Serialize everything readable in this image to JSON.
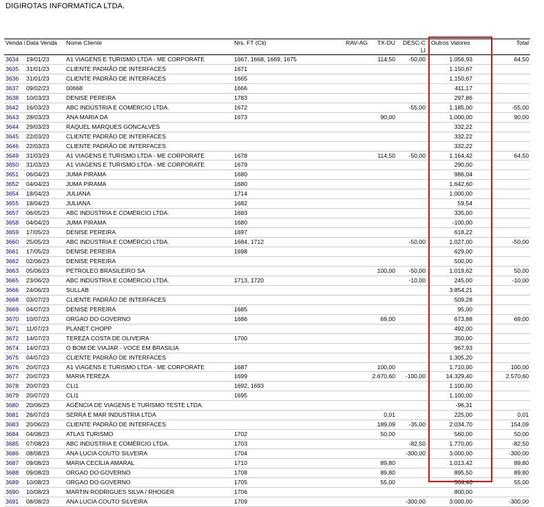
{
  "company": "DIGIROTAS INFORMATICA LTDA.",
  "headers": {
    "venda": "Venda Nº",
    "data": "Data Venda",
    "cliente": "Nome Cliente",
    "nrs": "Nrs. FT (Cli)",
    "rav": "RAV-AG",
    "tx": "TX-DU",
    "desc": "DESC-C LI",
    "outros": "Outros Valores",
    "total": "Total"
  },
  "highlight_color": "#e01010",
  "rows": [
    {
      "venda": "3634",
      "data": "19/01/23",
      "cliente": "A1 VIAGENS E TURISMO LTDA - ME CORPORATE",
      "nrs": "1667, 1668, 1669, 1675",
      "rav": "",
      "tx": "114,50",
      "desc": "-50,00",
      "outros": "1.056,93",
      "total": "64,50"
    },
    {
      "venda": "3635",
      "data": "31/01/23",
      "cliente": "CLIENTE PADRÃO DE INTERFACES",
      "nrs": "1671",
      "rav": "",
      "tx": "",
      "desc": "",
      "outros": "1.150,67",
      "total": ""
    },
    {
      "venda": "3636",
      "data": "31/01/23",
      "cliente": "CLIENTE PADRÃO DE INTERFACES",
      "nrs": "1665",
      "rav": "",
      "tx": "",
      "desc": "",
      "outros": "1.150,67",
      "total": ""
    },
    {
      "venda": "3637",
      "data": "09/02/23",
      "cliente": "00668",
      "nrs": "1666",
      "rav": "",
      "tx": "",
      "desc": "",
      "outros": "411,17",
      "total": ""
    },
    {
      "venda": "3638",
      "data": "10/03/23",
      "cliente": "DENISE PEREIRA",
      "nrs": "1783",
      "rav": "",
      "tx": "",
      "desc": "",
      "outros": "297,86",
      "total": ""
    },
    {
      "venda": "3642",
      "data": "16/03/23",
      "cliente": "ABC INDÚSTRIA E COMÉRCIO LTDA.",
      "nrs": "1672",
      "rav": "",
      "tx": "",
      "desc": "-55,00",
      "outros": "1.185,00",
      "total": "-55,00"
    },
    {
      "venda": "3643",
      "data": "28/03/23",
      "cliente": "ANA MARIA DA",
      "nrs": "1673",
      "rav": "",
      "tx": "90,00",
      "desc": "",
      "outros": "1.000,00",
      "total": "90,00"
    },
    {
      "venda": "3644",
      "data": "29/03/23",
      "cliente": "RAQUEL MARQUES GONCALVES",
      "nrs": "",
      "rav": "",
      "tx": "",
      "desc": "",
      "outros": "332,22",
      "total": ""
    },
    {
      "venda": "3645",
      "data": "22/03/23",
      "cliente": "CLIENTE PADRÃO DE INTERFACES",
      "nrs": "",
      "rav": "",
      "tx": "",
      "desc": "",
      "outros": "332,22",
      "total": ""
    },
    {
      "venda": "3646",
      "data": "22/03/23",
      "cliente": "CLIENTE PADRÃO DE INTERFACES",
      "nrs": "",
      "rav": "",
      "tx": "",
      "desc": "",
      "outros": "332,22",
      "total": ""
    },
    {
      "venda": "3649",
      "data": "31/03/23",
      "cliente": "A1 VIAGENS E TURISMO LTDA - ME CORPORATE",
      "nrs": "1678",
      "rav": "",
      "tx": "114,50",
      "desc": "-50,00",
      "outros": "1.164,42",
      "total": "64,50"
    },
    {
      "venda": "3650",
      "data": "31/03/23",
      "cliente": "A1 VIAGENS E TURISMO LTDA - ME CORPORATE",
      "nrs": "1679",
      "rav": "",
      "tx": "",
      "desc": "",
      "outros": "290,00",
      "total": ""
    },
    {
      "venda": "3651",
      "data": "06/04/23",
      "cliente": "JUMA PIRAMA",
      "nrs": "1680",
      "rav": "",
      "tx": "",
      "desc": "",
      "outros": "986,04",
      "total": ""
    },
    {
      "venda": "3652",
      "data": "04/04/23",
      "cliente": "JUMA PIRAMA",
      "nrs": "1680",
      "rav": "",
      "tx": "",
      "desc": "",
      "outros": "1.642,60",
      "total": ""
    },
    {
      "venda": "3654",
      "data": "18/04/23",
      "cliente": "JULIANA",
      "nrs": "1714",
      "rav": "",
      "tx": "",
      "desc": "",
      "outros": "1.000,00",
      "total": ""
    },
    {
      "venda": "3655",
      "data": "18/04/23",
      "cliente": "JULIANA",
      "nrs": "1682",
      "rav": "",
      "tx": "",
      "desc": "",
      "outros": "59,54",
      "total": ""
    },
    {
      "venda": "3657",
      "data": "06/05/23",
      "cliente": "ABC INDÚSTRIA E COMÉRCIO LTDA.",
      "nrs": "1683",
      "rav": "",
      "tx": "",
      "desc": "",
      "outros": "335,00",
      "total": ""
    },
    {
      "venda": "3658",
      "data": "04/04/23",
      "cliente": "JUMA PIRAMA",
      "nrs": "1680",
      "rav": "",
      "tx": "",
      "desc": "",
      "outros": "-100,00",
      "total": ""
    },
    {
      "venda": "3659",
      "data": "17/05/23",
      "cliente": "DENISE PEREIRA",
      "nrs": "1697",
      "rav": "",
      "tx": "",
      "desc": "",
      "outros": "618,22",
      "total": ""
    },
    {
      "venda": "3660",
      "data": "25/05/23",
      "cliente": "ABC INDÚSTRIA E COMÉRCIO LTDA.",
      "nrs": "1684, 1712",
      "rav": "",
      "tx": "",
      "desc": "-50,00",
      "outros": "1.027,00",
      "total": "-50,00"
    },
    {
      "venda": "3661",
      "data": "17/05/23",
      "cliente": "DENISE PEREIRA",
      "nrs": "1698",
      "rav": "",
      "tx": "",
      "desc": "",
      "outros": "629,00",
      "total": ""
    },
    {
      "venda": "3662",
      "data": "02/06/23",
      "cliente": "DENISE PEREIRA",
      "nrs": "",
      "rav": "",
      "tx": "",
      "desc": "",
      "outros": "500,00",
      "total": ""
    },
    {
      "venda": "3663",
      "data": "05/06/23",
      "cliente": "PETROLEO BRASILEIRO SA",
      "nrs": "",
      "rav": "",
      "tx": "100,00",
      "desc": "-50,00",
      "outros": "1.019,62",
      "total": "50,00"
    },
    {
      "venda": "3665",
      "data": "23/06/23",
      "cliente": "ABC INDÚSTRIA E COMÉRCIO LTDA.",
      "nrs": "1713, 1720",
      "rav": "",
      "tx": "",
      "desc": "-10,00",
      "outros": "245,00",
      "total": "-10,00"
    },
    {
      "venda": "3666",
      "data": "24/06/23",
      "cliente": "SULLAB",
      "nrs": "",
      "rav": "",
      "tx": "",
      "desc": "",
      "outros": "3.854,21",
      "total": ""
    },
    {
      "venda": "3668",
      "data": "03/07/23",
      "cliente": "CLIENTE PADRÃO DE INTERFACES",
      "nrs": "",
      "rav": "",
      "tx": "",
      "desc": "",
      "outros": "509,28",
      "total": ""
    },
    {
      "venda": "3669",
      "data": "04/07/23",
      "cliente": "DENISE PEREIRA",
      "nrs": "1685",
      "rav": "",
      "tx": "",
      "desc": "",
      "outros": "95,00",
      "total": ""
    },
    {
      "venda": "3670",
      "data": "10/07/23",
      "cliente": "ORGAO DO GOVERNO",
      "nrs": "1686",
      "rav": "",
      "tx": "69,00",
      "desc": "",
      "outros": "673,88",
      "total": "69,00"
    },
    {
      "venda": "3671",
      "data": "11/07/23",
      "cliente": "PLANET CHOPP",
      "nrs": "",
      "rav": "",
      "tx": "",
      "desc": "",
      "outros": "492,00",
      "total": ""
    },
    {
      "venda": "3672",
      "data": "14/07/23",
      "cliente": "TEREZA COSTA DE OLIVEIRA",
      "nrs": "1700",
      "rav": "",
      "tx": "",
      "desc": "",
      "outros": "350,00",
      "total": ""
    },
    {
      "venda": "3674",
      "data": "14/07/23",
      "cliente": "O BOM DE VIAJAR - VOCE EM BRASILIA",
      "nrs": "",
      "rav": "",
      "tx": "",
      "desc": "",
      "outros": "967,93",
      "total": ""
    },
    {
      "venda": "3675",
      "data": "04/07/23",
      "cliente": "CLIENTE PADRÃO DE INTERFACES",
      "nrs": "",
      "rav": "",
      "tx": "",
      "desc": "",
      "outros": "1.305,20",
      "total": ""
    },
    {
      "venda": "3676",
      "data": "20/07/23",
      "cliente": "A1 VIAGENS E TURISMO LTDA - ME CORPORATE",
      "nrs": "1687",
      "rav": "",
      "tx": "100,00",
      "desc": "",
      "outros": "1.710,00",
      "total": "100,00"
    },
    {
      "venda": "3677",
      "data": "20/07/23",
      "cliente": "MARIA TEREZA",
      "nrs": "1699",
      "rav": "",
      "tx": "2.670,60",
      "desc": "-100,00",
      "outros": "14.329,40",
      "total": "2.570,60"
    },
    {
      "venda": "3678",
      "data": "20/07/23",
      "cliente": "CLI1",
      "nrs": "1692, 1693",
      "rav": "",
      "tx": "",
      "desc": "",
      "outros": "1.100,00",
      "total": ""
    },
    {
      "venda": "3679",
      "data": "20/07/23",
      "cliente": "CLI1",
      "nrs": "1695",
      "rav": "",
      "tx": "",
      "desc": "",
      "outros": "1.100,00",
      "total": ""
    },
    {
      "venda": "3680",
      "data": "20/06/23",
      "cliente": "AGÊNCIA DE VIAGENS E TURISMO TESTE LTDA.",
      "nrs": "",
      "rav": "",
      "tx": "",
      "desc": "",
      "outros": "-96,31",
      "total": ""
    },
    {
      "venda": "3681",
      "data": "26/07/23",
      "cliente": "SERRA E MAR INDUSTRIA LTDA",
      "nrs": "",
      "rav": "",
      "tx": "0,01",
      "desc": "",
      "outros": "225,00",
      "total": "0,01"
    },
    {
      "venda": "3683",
      "data": "20/06/23",
      "cliente": "CLIENTE PADRÃO DE INTERFACES",
      "nrs": "",
      "rav": "",
      "tx": "189,09",
      "desc": "-35,00",
      "outros": "2.034,70",
      "total": "154,09"
    },
    {
      "venda": "3684",
      "data": "04/08/23",
      "cliente": "ATLAS TURISMO",
      "nrs": "1702",
      "rav": "",
      "tx": "50,00",
      "desc": "",
      "outros": "560,00",
      "total": "50,00"
    },
    {
      "venda": "3685",
      "data": "07/08/23",
      "cliente": "ABC INDÚSTRIA E COMÉRCIO LTDA.",
      "nrs": "1703",
      "rav": "",
      "tx": "",
      "desc": "-82,50",
      "outros": "1.770,00",
      "total": "-82,50"
    },
    {
      "venda": "3686",
      "data": "08/08/23",
      "cliente": "ANA LUCIA COUTO SILVEIRA",
      "nrs": "1704",
      "rav": "",
      "tx": "",
      "desc": "-300,00",
      "outros": "3.000,00",
      "total": "-300,00"
    },
    {
      "venda": "3687",
      "data": "09/08/23",
      "cliente": "MARIA CECÍLIA AMARAL",
      "nrs": "1710",
      "rav": "",
      "tx": "89,80",
      "desc": "",
      "outros": "1.013,42",
      "total": "89,80"
    },
    {
      "venda": "3688",
      "data": "09/08/23",
      "cliente": "ORGAO DO GOVERNO",
      "nrs": "1708",
      "rav": "",
      "tx": "89,80",
      "desc": "",
      "outros": "895,50",
      "total": "89,80"
    },
    {
      "venda": "3689",
      "data": "10/08/23",
      "cliente": "ORGAO DO GOVERNO",
      "nrs": "1705",
      "rav": "",
      "tx": "55,00",
      "desc": "",
      "outros": "564,46",
      "total": "55,00"
    },
    {
      "venda": "3690",
      "data": "10/08/23",
      "cliente": "MARTIN RODRIGUES SILVA / RHOGER",
      "nrs": "1706",
      "rav": "",
      "tx": "",
      "desc": "",
      "outros": "800,00",
      "total": ""
    },
    {
      "venda": "3691",
      "data": "08/08/23",
      "cliente": "ANA LUCIA COUTO SILVEIRA",
      "nrs": "1709",
      "rav": "",
      "tx": "",
      "desc": "-300,00",
      "outros": "3.000,00",
      "total": "-300,00"
    }
  ]
}
